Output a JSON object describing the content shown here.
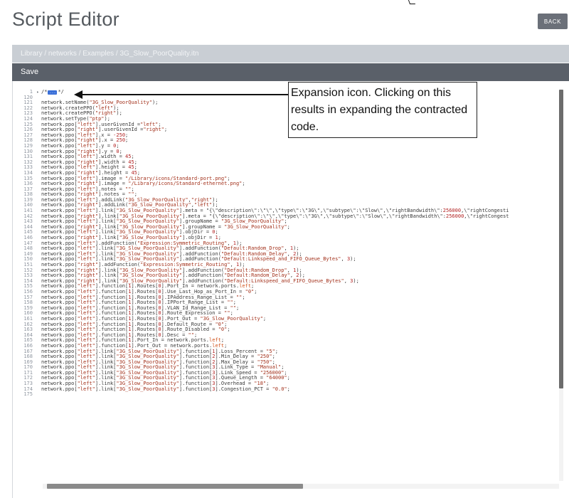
{
  "header": {
    "title": "Script Editor",
    "back_label": "BACK"
  },
  "breadcrumb": "Library / networks / Examples / 3G_Slow_PoorQuality.itn",
  "toolbar": {
    "save_label": "Save"
  },
  "annotation": "Expansion icon. Clicking on this results in expanding the contracted code.",
  "editor": {
    "fold_row": {
      "line": "1",
      "toggle_icon": "right-triangle",
      "prefix": "/*",
      "marker": "...",
      "suffix": "*/"
    },
    "lines": [
      {
        "n": "120",
        "t": ""
      },
      {
        "n": "121",
        "t": "network.setName(\"3G_Slow_PoorQuality\");"
      },
      {
        "n": "122",
        "t": "network.createPPO(\"left\");"
      },
      {
        "n": "123",
        "t": "network.createPPO(\"right\");"
      },
      {
        "n": "124",
        "t": "network.setType(\"ptp\");"
      },
      {
        "n": "125",
        "t": "network.ppo[\"left\"].userGivenId =\"left\";"
      },
      {
        "n": "126",
        "t": "network.ppo[\"right\"].userGivenId =\"right\";"
      },
      {
        "n": "127",
        "t": "network.ppo[\"left\"].x = -250;"
      },
      {
        "n": "128",
        "t": "network.ppo[\"right\"].x = 250;"
      },
      {
        "n": "129",
        "t": "network.ppo[\"left\"].y = 0;"
      },
      {
        "n": "130",
        "t": "network.ppo[\"right\"].y = 0;"
      },
      {
        "n": "131",
        "t": "network.ppo[\"left\"].width = 45;"
      },
      {
        "n": "132",
        "t": "network.ppo[\"right\"].width = 45;"
      },
      {
        "n": "133",
        "t": "network.ppo[\"left\"].height = 45;"
      },
      {
        "n": "134",
        "t": "network.ppo[\"right\"].height = 45;"
      },
      {
        "n": "135",
        "t": "network.ppo[\"left\"].image = \"/Library/icons/Standard-port.png\";"
      },
      {
        "n": "136",
        "t": "network.ppo[\"right\"].image = \"/Library/icons/Standard-ethernet.png\";"
      },
      {
        "n": "137",
        "t": "network.ppo[\"left\"].notes = \"\";"
      },
      {
        "n": "138",
        "t": "network.ppo[\"right\"].notes = \"\";"
      },
      {
        "n": "139",
        "t": "network.ppo[\"left\"].addLink(\"3G_Slow_PoorQuality\",\"right\");"
      },
      {
        "n": "140",
        "t": "network.ppo[\"right\"].addLink(\"3G_Slow_PoorQuality\",\"left\");"
      },
      {
        "n": "141",
        "t": "network.ppo[\"left\"].link[\"3G_Slow_PoorQuality\"].meta = \"{\\\"description\\\":\\\"\\\",\\\"type\\\":\\\"3G\\\",\\\"subtype\\\":\\\"Slow\\\",\\\"rightBandwidth\\\":256000,\\\"rightCongesti"
      },
      {
        "n": "142",
        "t": "network.ppo[\"right\"].link[\"3G_Slow_PoorQuality\"].meta = \"{\\\"description\\\":\\\"\\\",\\\"type\\\":\\\"3G\\\",\\\"subtype\\\":\\\"Slow\\\",\\\"rightBandwidth\\\":256000,\\\"rightCongest"
      },
      {
        "n": "143",
        "t": "network.ppo[\"left\"].link[\"3G_Slow_PoorQuality\"].groupName = \"3G_Slow_PoorQuality\";"
      },
      {
        "n": "144",
        "t": "network.ppo[\"right\"].link[\"3G_Slow_PoorQuality\"].groupName = \"3G_Slow_PoorQuality\";"
      },
      {
        "n": "145",
        "t": "network.ppo[\"left\"].link[\"3G_Slow_PoorQuality\"].objDir = 0;"
      },
      {
        "n": "146",
        "t": "network.ppo[\"right\"].link[\"3G_Slow_PoorQuality\"].objDir = 1;"
      },
      {
        "n": "147",
        "t": "network.ppo[\"left\"].addFunction(\"Expression:Symmetric_Routing\", 1);"
      },
      {
        "n": "148",
        "t": "network.ppo[\"left\"].link[\"3G_Slow_PoorQuality\"].addFunction(\"Default:Random_Drop\", 1);"
      },
      {
        "n": "149",
        "t": "network.ppo[\"left\"].link[\"3G_Slow_PoorQuality\"].addFunction(\"Default:Random_Delay\", 2);"
      },
      {
        "n": "150",
        "t": "network.ppo[\"left\"].link[\"3G_Slow_PoorQuality\"].addFunction(\"Default:Linkspeed_and_FIFO_Queue_Bytes\", 3);"
      },
      {
        "n": "151",
        "t": "network.ppo[\"right\"].addFunction(\"Expression:Symmetric_Routing\", 1);"
      },
      {
        "n": "152",
        "t": "network.ppo[\"right\"].link[\"3G_Slow_PoorQuality\"].addFunction(\"Default:Random_Drop\", 1);"
      },
      {
        "n": "153",
        "t": "network.ppo[\"right\"].link[\"3G_Slow_PoorQuality\"].addFunction(\"Default:Random_Delay\", 2);"
      },
      {
        "n": "154",
        "t": "network.ppo[\"right\"].link[\"3G_Slow_PoorQuality\"].addFunction(\"Default:Linkspeed_and_FIFO_Queue_Bytes\", 3);"
      },
      {
        "n": "155",
        "t": "network.ppo[\"left\"].function[1].Routes[0].Port_In = network.ports.left;"
      },
      {
        "n": "156",
        "t": "network.ppo[\"left\"].function[1].Routes[0].Use_Last_Hop_as_Port_In = \"0\";"
      },
      {
        "n": "157",
        "t": "network.ppo[\"left\"].function[1].Routes[0].IPAddress_Range_List = \"\";"
      },
      {
        "n": "158",
        "t": "network.ppo[\"left\"].function[1].Routes[0].IPPort_Range_List = \"\";"
      },
      {
        "n": "159",
        "t": "network.ppo[\"left\"].function[1].Routes[0].VLAN_Id_Range_List = \"\";"
      },
      {
        "n": "160",
        "t": "network.ppo[\"left\"].function[1].Routes[0].Route_Expression = \"\";"
      },
      {
        "n": "161",
        "t": "network.ppo[\"left\"].function[1].Routes[0].Port_Out = \"3G_Slow_PoorQuality\";"
      },
      {
        "n": "162",
        "t": "network.ppo[\"left\"].function[1].Routes[0].Default_Route = \"0\";"
      },
      {
        "n": "163",
        "t": "network.ppo[\"left\"].function[1].Routes[0].Route_Disabled = \"0\";"
      },
      {
        "n": "164",
        "t": "network.ppo[\"left\"].function[1].Routes[0].Desc = \"\";"
      },
      {
        "n": "165",
        "t": "network.ppo[\"left\"].function[1].Port_In = network.ports.left;"
      },
      {
        "n": "166",
        "t": "network.ppo[\"left\"].function[1].Port_Out = network.ports.left;"
      },
      {
        "n": "167",
        "t": "network.ppo[\"left\"].link[\"3G_Slow_PoorQuality\"].function[1].Loss_Percent = \"5\";"
      },
      {
        "n": "168",
        "t": "network.ppo[\"left\"].link[\"3G_Slow_PoorQuality\"].function[2].Min_Delay = \"250\";"
      },
      {
        "n": "169",
        "t": "network.ppo[\"left\"].link[\"3G_Slow_PoorQuality\"].function[2].Max_Delay = \"750\";"
      },
      {
        "n": "170",
        "t": "network.ppo[\"left\"].link[\"3G_Slow_PoorQuality\"].function[3].Link_Type = \"Manual\";"
      },
      {
        "n": "171",
        "t": "network.ppo[\"left\"].link[\"3G_Slow_PoorQuality\"].function[3].Link_Speed = \"256000\";"
      },
      {
        "n": "172",
        "t": "network.ppo[\"left\"].link[\"3G_Slow_PoorQuality\"].function[3].Queue_Length = \"64000\";"
      },
      {
        "n": "173",
        "t": "network.ppo[\"left\"].link[\"3G_Slow_PoorQuality\"].function[3].Overhead = \"18\";"
      },
      {
        "n": "174",
        "t": "network.ppo[\"left\"].link[\"3G_Slow_PoorQuality\"].function[3].Congestion_PCT = \"0.0\";"
      },
      {
        "n": "175",
        "t": ""
      }
    ]
  }
}
